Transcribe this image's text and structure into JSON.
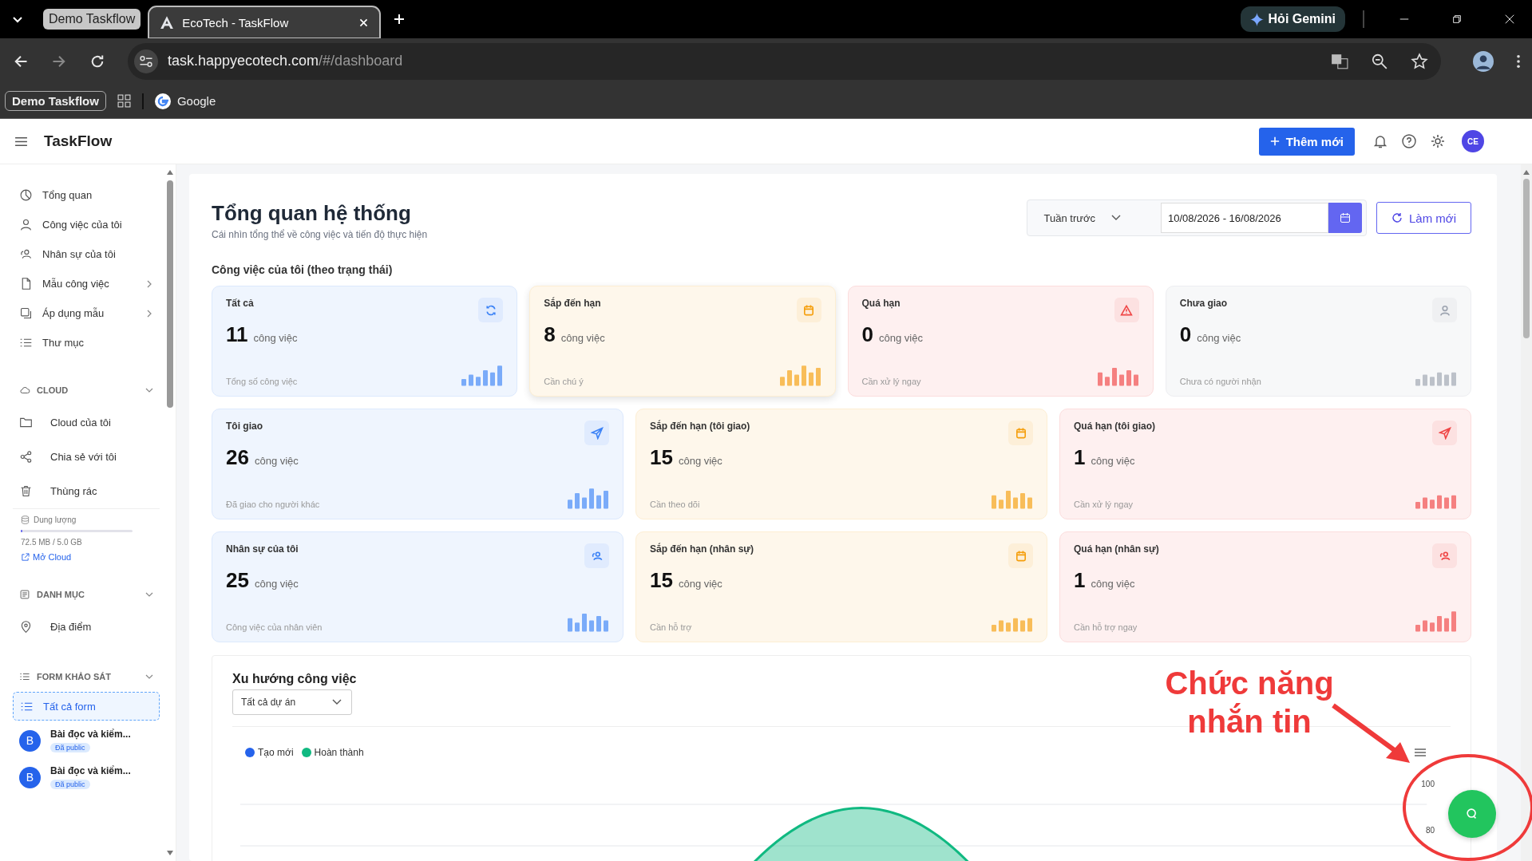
{
  "browser": {
    "tab_group": "Demo Taskflow",
    "tabs": [
      {
        "title": "EcoTech - TaskFlow",
        "selected": true
      }
    ],
    "gemini_button": "Hỏi Gemini",
    "url_host": "task.happyecotech.com",
    "url_path": "/#/dashboard",
    "bookmarks": [
      {
        "label": "Demo Taskflow",
        "kind": "group"
      },
      {
        "label": "Google",
        "kind": "site"
      }
    ]
  },
  "app": {
    "title": "TaskFlow",
    "add_button": "Thêm mới",
    "avatar": "CE"
  },
  "sidebar": [
    {
      "kind": "nav",
      "label": "Tổng quan",
      "submenu": false,
      "selected": false
    },
    {
      "kind": "nav",
      "label": "Công việc của tôi",
      "submenu": false,
      "selected": false
    },
    {
      "kind": "nav",
      "label": "Nhân sự của tôi",
      "submenu": false,
      "selected": false
    },
    {
      "kind": "nav",
      "label": "Mẫu công việc",
      "submenu": true,
      "selected": false
    },
    {
      "kind": "nav",
      "label": "Áp dụng mẫu",
      "submenu": true,
      "selected": false
    },
    {
      "kind": "nav",
      "label": "Thư mục",
      "submenu": false,
      "selected": false
    },
    {
      "kind": "section",
      "label": "CLOUD",
      "expanded": true
    },
    {
      "kind": "subnav",
      "label": "Cloud của tôi",
      "selected": false
    },
    {
      "kind": "subnav",
      "label": "Chia sẻ với tôi",
      "selected": false
    },
    {
      "kind": "subnav",
      "label": "Thùng rác",
      "selected": false
    },
    {
      "kind": "storage",
      "label": "Dung lượng",
      "level": 0.015,
      "reading": "72.5 MB / 5.0 GB",
      "link": "Mở Cloud"
    },
    {
      "kind": "section",
      "label": "DANH MỤC",
      "expanded": true
    },
    {
      "kind": "subnav",
      "label": "Địa điểm",
      "selected": false
    },
    {
      "kind": "section",
      "label": "FORM KHẢO SÁT",
      "expanded": true
    },
    {
      "kind": "nav",
      "label": "Tất cả form",
      "submenu": false,
      "selected": true
    },
    {
      "kind": "form",
      "initial": "B",
      "label": "Bài đọc và kiểm...",
      "badge": "Đã public"
    },
    {
      "kind": "form",
      "initial": "B",
      "label": "Bài đọc và kiểm...",
      "badge": "Đã public"
    }
  ],
  "dashboard": {
    "title": "Tổng quan hệ thống",
    "subtitle": "Cái nhìn tổng thể về công việc và tiến độ thực hiện",
    "period": "Tuần trước",
    "date_range": "10/08/2026 - 16/08/2026",
    "refresh_button": "Làm mới",
    "section_title": "Công việc của tôi (theo trạng thái)",
    "stat_rows": [
      [
        {
          "label": "Tất cả",
          "count": "11",
          "unit": "công việc",
          "note": "Tổng số công việc",
          "color": "#3b82f6",
          "hovered": false
        },
        {
          "label": "Sắp đến hạn",
          "count": "8",
          "unit": "công việc",
          "note": "Cần chú ý",
          "color": "#f59e0b",
          "hovered": true
        },
        {
          "label": "Quá hạn",
          "count": "0",
          "unit": "công việc",
          "note": "Cần xử lý ngay",
          "color": "#ef4444",
          "hovered": false
        },
        {
          "label": "Chưa giao",
          "count": "0",
          "unit": "công việc",
          "note": "Chưa có người nhận",
          "color": "#9ca3af",
          "hovered": false
        }
      ],
      [
        {
          "label": "Tôi giao",
          "count": "26",
          "unit": "công việc",
          "note": "Đã giao cho người khác",
          "color": "#3b82f6",
          "hovered": false
        },
        {
          "label": "Sắp đến hạn (tôi giao)",
          "count": "15",
          "unit": "công việc",
          "note": "Cần theo dõi",
          "color": "#f59e0b",
          "hovered": false
        },
        {
          "label": "Quá hạn (tôi giao)",
          "count": "1",
          "unit": "công việc",
          "note": "Cần xử lý ngay",
          "color": "#ef4444",
          "hovered": false
        }
      ],
      [
        {
          "label": "Nhân sự của tôi",
          "count": "25",
          "unit": "công việc",
          "note": "Công việc của nhân viên",
          "color": "#3b82f6",
          "hovered": false
        },
        {
          "label": "Sắp đến hạn (nhân sự)",
          "count": "15",
          "unit": "công việc",
          "note": "Cần hỗ trợ",
          "color": "#f59e0b",
          "hovered": false
        },
        {
          "label": "Quá hạn (nhân sự)",
          "count": "1",
          "unit": "công việc",
          "note": "Cần hỗ trợ ngay",
          "color": "#ef4444",
          "hovered": false
        }
      ]
    ],
    "trend": {
      "title": "Xu hướng công việc",
      "project_filter": "Tất cả dự án",
      "legend": [
        {
          "label": "Tạo mới",
          "color": "#2563eb"
        },
        {
          "label": "Hoàn thành",
          "color": "#10b981"
        }
      ],
      "y_labels": [
        "100",
        "80"
      ]
    }
  },
  "annotation": {
    "lines": [
      "Chức năng",
      "nhắn tin"
    ]
  }
}
